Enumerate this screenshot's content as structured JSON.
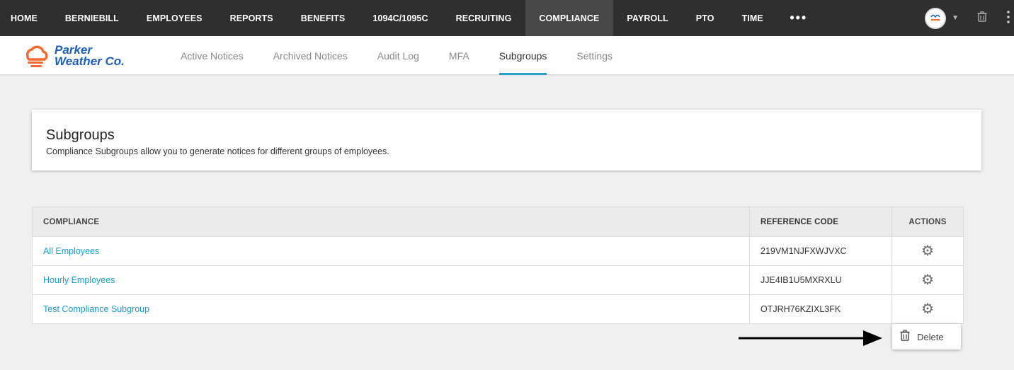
{
  "topnav": {
    "items": [
      "HOME",
      "BERNIEBILL",
      "EMPLOYEES",
      "REPORTS",
      "BENEFITS",
      "1094C/1095C",
      "RECRUITING",
      "COMPLIANCE",
      "PAYROLL",
      "PTO",
      "TIME"
    ],
    "active": "COMPLIANCE",
    "more_label": "•••"
  },
  "logo": {
    "line1": "Parker",
    "line2": "Weather Co."
  },
  "subnav": {
    "tabs": [
      "Active Notices",
      "Archived Notices",
      "Audit Log",
      "MFA",
      "Subgroups",
      "Settings"
    ],
    "active": "Subgroups"
  },
  "card": {
    "title": "Subgroups",
    "description": "Compliance Subgroups allow you to generate notices for different groups of employees."
  },
  "table": {
    "columns": [
      "COMPLIANCE",
      "REFERENCE CODE",
      "ACTIONS"
    ],
    "rows": [
      {
        "name": "All Employees",
        "code": "219VM1NJFXWJVXC"
      },
      {
        "name": "Hourly Employees",
        "code": "JJE4IB1U5MXRXLU"
      },
      {
        "name": "Test Compliance Subgroup",
        "code": "OTJRH76KZIXL3FK"
      }
    ]
  },
  "menu": {
    "delete_label": "Delete"
  },
  "colors": {
    "nav_bg": "#2f2f2f",
    "active_nav": "#474747",
    "accent": "#2aa0cf",
    "link": "#1e9cc8",
    "logo": "#1c5fb3",
    "logo_orange": "#f26a2e"
  }
}
